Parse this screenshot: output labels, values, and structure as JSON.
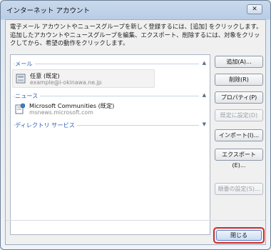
{
  "window": {
    "title": "インターネット アカウント",
    "close_glyph": "✕"
  },
  "description": "電子メール アカウントやニュースグループを新しく登録するには、[追加] をクリックします。追加したアカウントやニュースグループを編集、エクスポート、削除するには、対象をクリックしてから、希望の動作をクリックします。",
  "groups": {
    "mail": {
      "label": "メール",
      "chevron": "▲"
    },
    "news": {
      "label": "ニュース",
      "chevron": "▲"
    },
    "directory": {
      "label": "ディレクトリ サービス",
      "chevron": "▼"
    }
  },
  "accounts": {
    "mail": [
      {
        "name": "任意 (既定)",
        "sub": "example@i-okinawa.ne.jp",
        "icon": "mail-account-icon"
      }
    ],
    "news": [
      {
        "name": "Microsoft Communities (既定)",
        "sub": "msnews.microsoft.com",
        "icon": "news-account-icon"
      }
    ]
  },
  "buttons": {
    "add": "追加(A)...",
    "delete": "削除(R)",
    "properties": "プロパティ(P)",
    "set_default": "既定に設定(D)",
    "import": "インポート(I)...",
    "export": "エクスポート(E)...",
    "order": "順番の設定(S)...",
    "close": "閉じる"
  },
  "colors": {
    "group_label": "#2e5fb0",
    "highlight": "#d0282e"
  }
}
